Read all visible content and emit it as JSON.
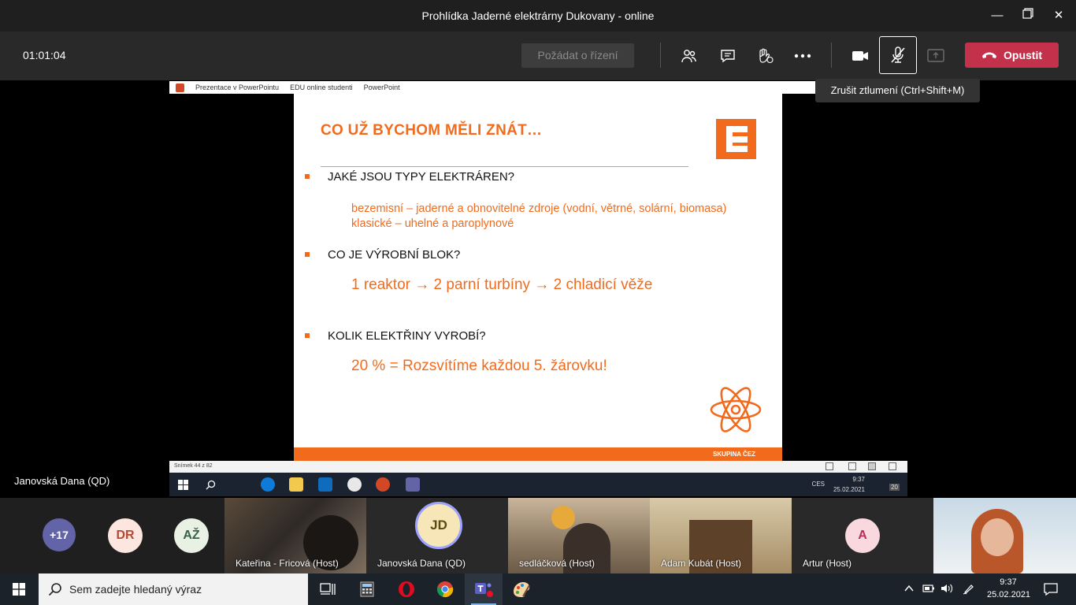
{
  "window": {
    "title": "Prohlídka Jaderné elektrárny Dukovany - online"
  },
  "meeting": {
    "timer": "01:01:04",
    "request_control_label": "Požádat o řízení",
    "leave_label": "Opustit",
    "mic_tooltip": "Zrušit ztlumení (Ctrl+Shift+M)"
  },
  "powerpoint": {
    "tabs": [
      "Prezentace v PowerPointu",
      "EDU online studenti",
      "PowerPoint"
    ],
    "status": "Snímek 44 z 82"
  },
  "slide": {
    "title": "CO UŽ BYCHOM MĚLI ZNÁT…",
    "q1": "JAKÉ JSOU TYPY ELEKTRÁREN?",
    "a1_line1": "bezemisní – jaderné a obnovitelné zdroje (vodní, větrné, solární, biomasa)",
    "a1_line2": "klasické – uhelné a paroplynové",
    "q2": "CO JE VÝROBNÍ BLOK?",
    "a2": "1 reaktor → 2 parní turbíny → 2 chladicí věže",
    "q3": "KOLIK ELEKTŘINY VYROBÍ?",
    "a3": "20 % = Rozsvítíme každou 5. žárovku!",
    "footer": "SKUPINA ČEZ"
  },
  "shared_taskbar": {
    "lang": "CES",
    "time": "9:37",
    "date": "25.02.2021",
    "notif_count": "20"
  },
  "presenter_label": "Janovská Dana (QD)",
  "participants": {
    "overflow": "+17",
    "initials": [
      "DR",
      "AŽ"
    ],
    "tiles": [
      {
        "name": "Kateřina - Fricová (Host)"
      },
      {
        "name": "Janovská Dana (QD)",
        "initials": "JD"
      },
      {
        "name": "sedláčková (Host)"
      },
      {
        "name": "Adam Kubát (Host)"
      },
      {
        "name": "Artur (Host)",
        "initials": "A"
      }
    ]
  },
  "taskbar": {
    "search_placeholder": "Sem zadejte hledaný výraz",
    "time": "9:37",
    "date": "25.02.2021"
  },
  "colors": {
    "brand_orange": "#f26b1d",
    "leave_red": "#c4314b",
    "teams_purple": "#6264a7"
  }
}
